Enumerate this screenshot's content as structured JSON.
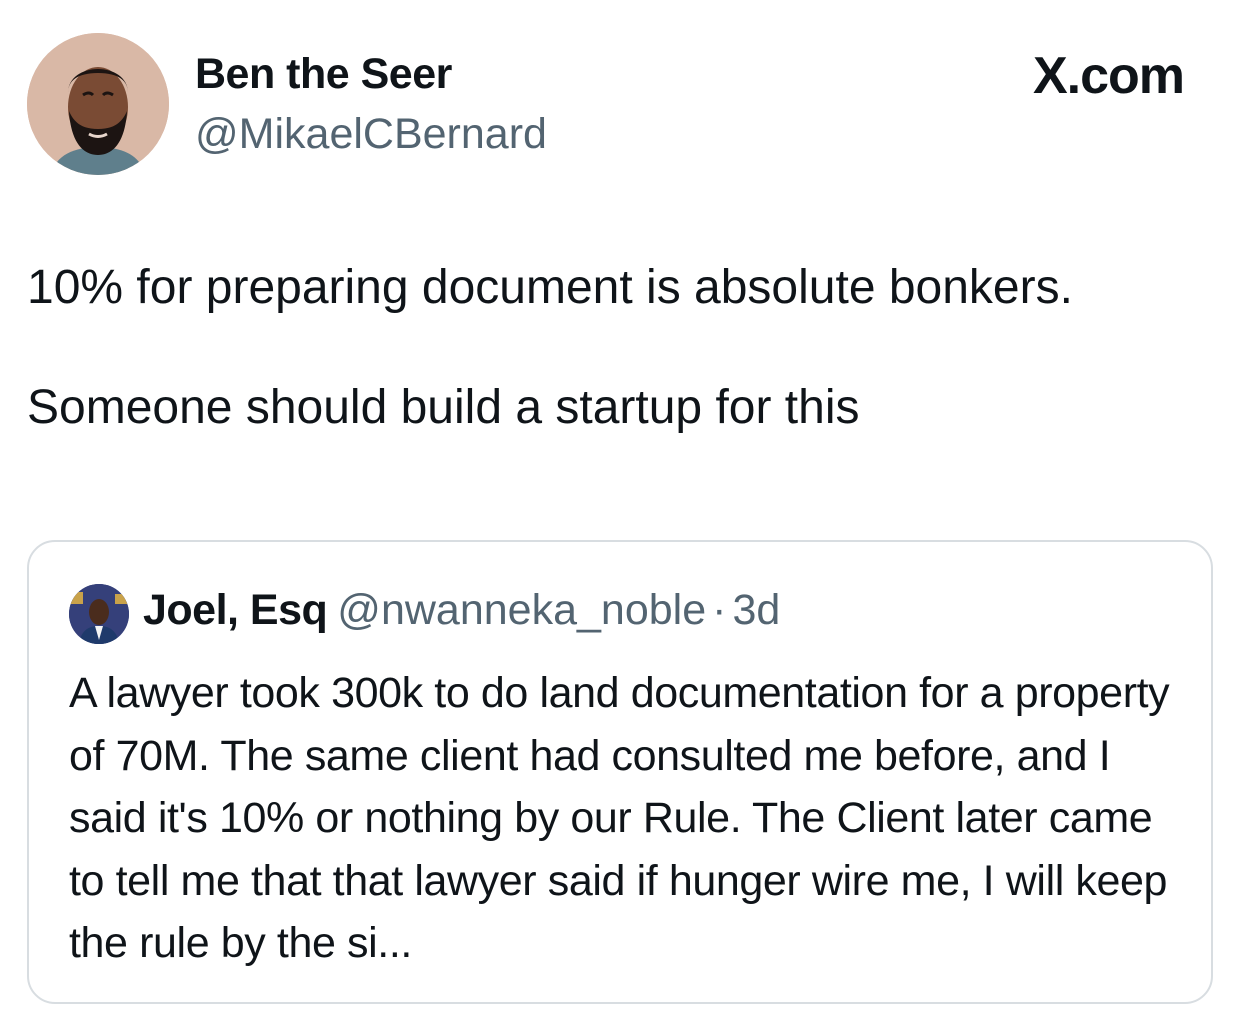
{
  "tweet": {
    "author_name": "Ben the Seer",
    "author_handle": "@MikaelCBernard",
    "brand": "X.com",
    "text": "10% for preparing document is absolute bonkers.\n\nSomeone should build a startup for this"
  },
  "quoted_tweet": {
    "author_name": "Joel, Esq",
    "author_handle": "@nwanneka_noble",
    "separator": "·",
    "time": "3d",
    "text": "A lawyer took 300k to do land documentation for a property of 70M. The same client had consulted me before, and I said it's 10% or nothing by our Rule. The Client later came to tell me that that lawyer said if hunger wire me, I will keep the rule by the si..."
  },
  "colors": {
    "text_primary": "#0f1419",
    "text_secondary": "#536471",
    "border": "#d8dde1"
  }
}
